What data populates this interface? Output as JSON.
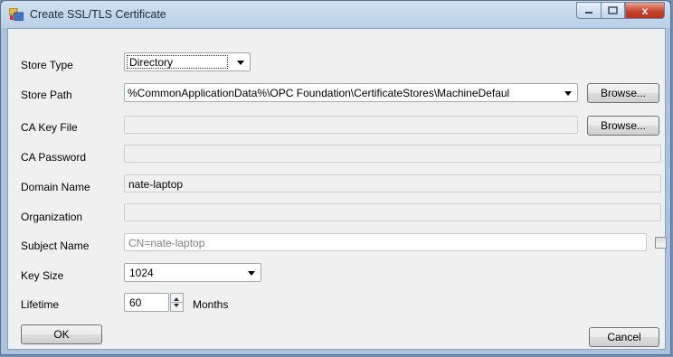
{
  "window": {
    "title": "Create SSL/TLS Certificate",
    "close_glyph": "x"
  },
  "form": {
    "store_type": {
      "label": "Store Type",
      "value": "Directory"
    },
    "store_path": {
      "label": "Store Path",
      "value": "%CommonApplicationData%\\OPC Foundation\\CertificateStores\\MachineDefaul",
      "button": "Browse..."
    },
    "ca_key_file": {
      "label": "CA Key File",
      "value": "",
      "button": "Browse..."
    },
    "ca_password": {
      "label": "CA Password",
      "value": ""
    },
    "domain_name": {
      "label": "Domain Name",
      "value": "nate-laptop"
    },
    "organization": {
      "label": "Organization",
      "value": ""
    },
    "subject_name": {
      "label": "Subject Name",
      "value": "CN=nate-laptop",
      "checked": false
    },
    "key_size": {
      "label": "Key Size",
      "value": "1024"
    },
    "lifetime": {
      "label": "Lifetime",
      "value": "60",
      "unit": "Months"
    }
  },
  "buttons": {
    "ok": "OK",
    "cancel": "Cancel"
  }
}
